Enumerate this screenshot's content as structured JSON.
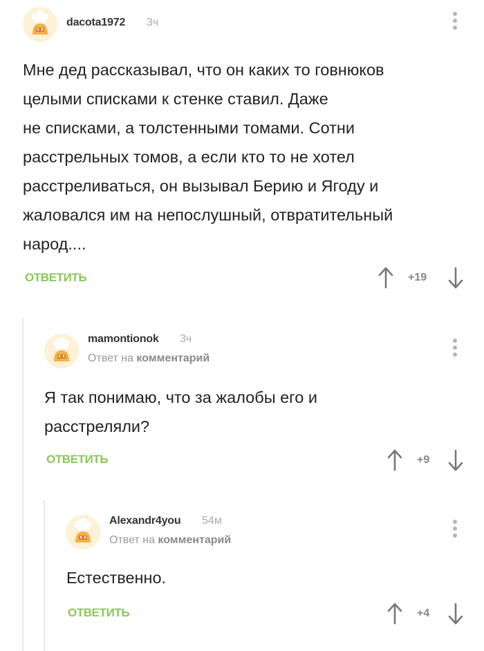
{
  "comments": [
    {
      "username": "dacota1972",
      "time": "3ч",
      "text_lines": [
        "Мне дед рассказывал, что он каких то говнюков",
        "целыми списками к стенке ставил. Даже",
        "не списками, а толстенными томами. Сотни",
        "расстрельных томов, а если кто то не хотел",
        "расстреливаться, он вызывал Берию и Ягоду и",
        "жаловался им на непослушный, отвратительный",
        "народ...."
      ],
      "reply_label": "ОТВЕТИТЬ",
      "rating": "+19"
    },
    {
      "username": "mamontionok",
      "time": "3ч",
      "reply_to_prefix": "Ответ на",
      "reply_to_target": "комментарий",
      "text_lines": [
        "Я так понимаю, что за жалобы его и",
        "расстреляли?"
      ],
      "reply_label": "ОТВЕТИТЬ",
      "rating": "+9"
    },
    {
      "username": "Alexandr4you",
      "time": "54м",
      "reply_to_prefix": "Ответ на",
      "reply_to_target": "комментарий",
      "text_lines": [
        "Естественно."
      ],
      "reply_label": "ОТВЕТИТЬ",
      "rating": "+4"
    }
  ],
  "icons": {
    "avatar": "chef-hat-avatar-icon",
    "menu": "more-vertical-icon",
    "upvote": "arrow-up-icon",
    "downvote": "arrow-down-icon"
  },
  "colors": {
    "accent_green": "#8ac858",
    "muted_gray": "#aaaaaa",
    "avatar_bg": "#fdf1d6"
  }
}
